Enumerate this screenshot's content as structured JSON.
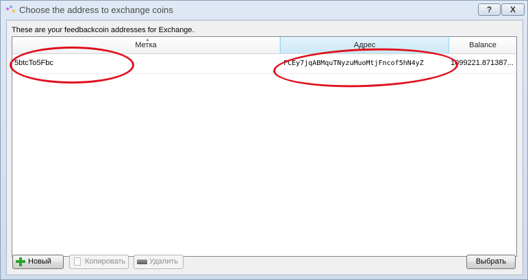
{
  "window": {
    "title": "Choose the address to exchange coins",
    "help_label": "?",
    "close_label": "X"
  },
  "hint": "These are your feedbackcoin addresses for Exchange.",
  "table": {
    "columns": {
      "label": "Метка",
      "address": "Адрес",
      "balance": "Balance"
    },
    "rows": [
      {
        "label": "5btcTo5Fbc",
        "address": "FCEy7jqABMquTNyzuMuoMtjFncof5hN4yZ",
        "balance": "1099221.871387..."
      }
    ]
  },
  "buttons": {
    "new": "Новый",
    "copy": "Копировать",
    "delete": "Удалить",
    "choose": "Выбрать"
  },
  "colors": {
    "annotation": "#e0101c",
    "plus_icon": "#2aa52a"
  }
}
